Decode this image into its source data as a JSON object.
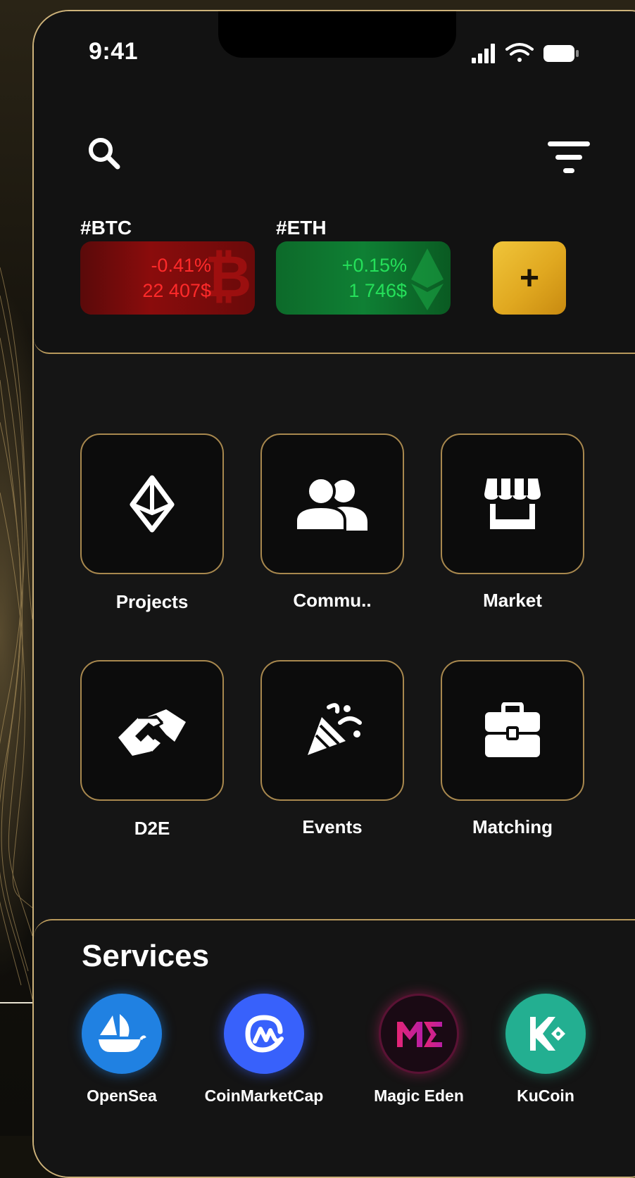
{
  "status_bar": {
    "time": "9:41"
  },
  "tickers": [
    {
      "label": "#BTC",
      "change": "-0.41%",
      "price": "22 407$",
      "color": "#ff2a2a"
    },
    {
      "label": "#ETH",
      "change": "+0.15%",
      "price": "1 746$",
      "color": "#25e05a"
    }
  ],
  "add_button": {
    "label": "+"
  },
  "tiles": [
    {
      "label": "Projects",
      "icon": "ethereum-icon"
    },
    {
      "label": "Commu..",
      "icon": "users-icon"
    },
    {
      "label": "Market",
      "icon": "store-icon"
    },
    {
      "label": "D2E",
      "icon": "handshake-icon"
    },
    {
      "label": "Events",
      "icon": "party-popper-icon"
    },
    {
      "label": "Matching",
      "icon": "briefcase-icon"
    }
  ],
  "services": {
    "title": "Services",
    "items": [
      {
        "name": "OpenSea",
        "color": "#2081e2"
      },
      {
        "name": "CoinMarketCap",
        "color": "#3861fb"
      },
      {
        "name": "Magic Eden",
        "color": "#e42575"
      },
      {
        "name": "KuCoin",
        "color": "#23af91"
      }
    ]
  },
  "colors": {
    "accent_gold": "#cdb27a",
    "button_gold": "#e0a820"
  }
}
